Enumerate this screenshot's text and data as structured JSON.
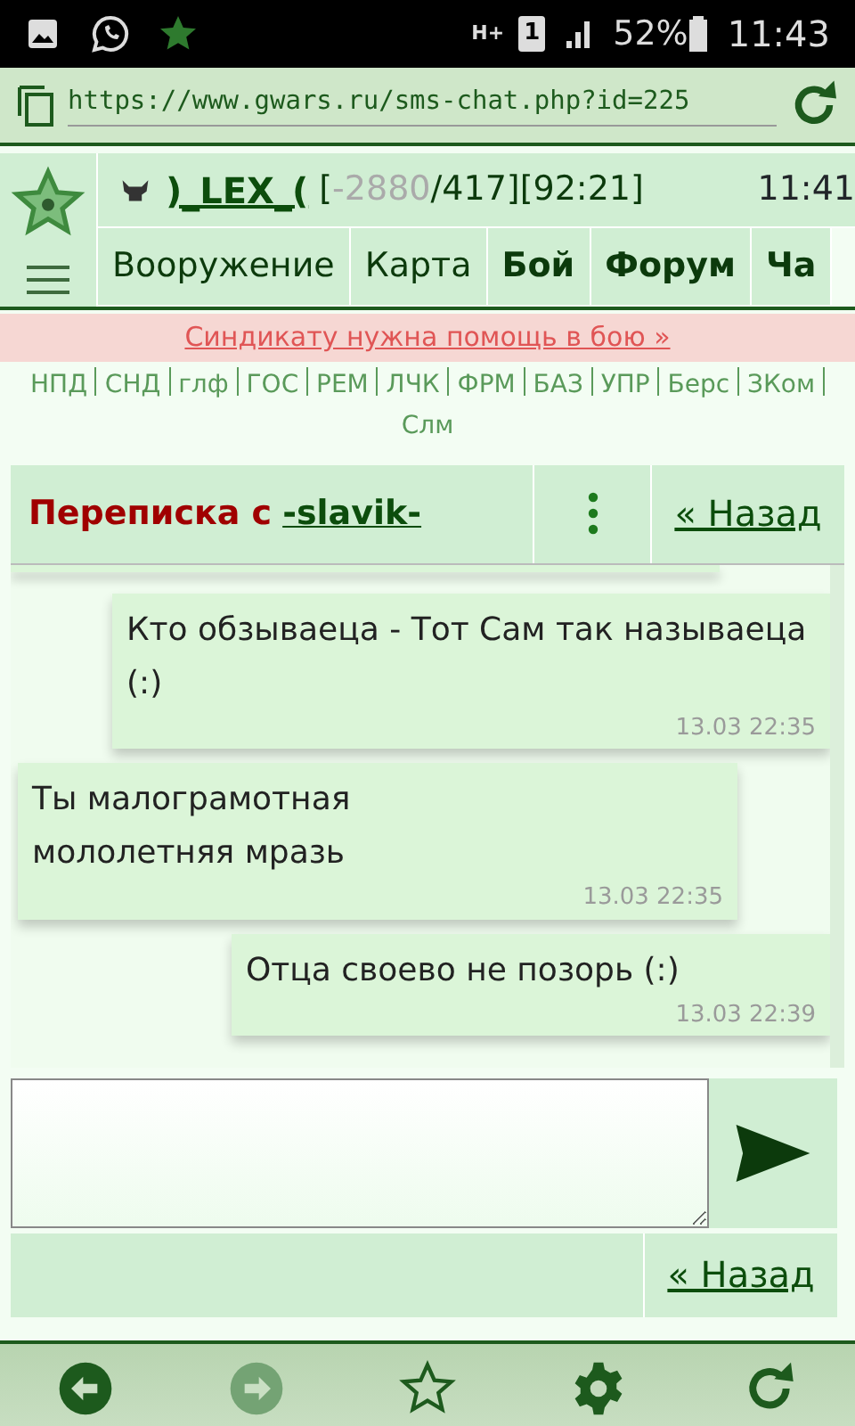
{
  "status_bar": {
    "network": "H+",
    "sim": "1",
    "battery": "52%",
    "time": "11:43"
  },
  "browser": {
    "url": "https://www.gwars.ru/sms-chat.php?id=225"
  },
  "header": {
    "player": ")_LEX_(",
    "stats": [
      {
        "text": "[",
        "kind": "plain"
      },
      {
        "text": "-2880",
        "kind": "muted"
      },
      {
        "text": "/417][92:21]",
        "kind": "plain"
      }
    ],
    "time": "11:41",
    "nav": [
      {
        "label": "Вооружение",
        "bold": false
      },
      {
        "label": "Карта",
        "bold": false
      },
      {
        "label": "Бой",
        "bold": true
      },
      {
        "label": "Форум",
        "bold": true
      },
      {
        "label": "Ча",
        "bold": true
      }
    ]
  },
  "alert": "Синдикату нужна помощь в бою »",
  "quick_links": [
    "НПД",
    "СНД",
    "глф",
    "ГОС",
    "РЕМ",
    "ЛЧК",
    "ФРМ",
    "БАЗ",
    "УПР",
    "Берс",
    "ЗКом",
    "Слм"
  ],
  "chat": {
    "title": "Переписка с",
    "contact": "-slavik-",
    "back": "« Назад",
    "messages": [
      {
        "kind": "out",
        "text": "Кто обзываеца - Тот Сам так называеца (:)",
        "time": "13.03 22:35"
      },
      {
        "kind": "in",
        "text": "Ты малограмотная мололетняя мразь",
        "time": "13.03 22:35"
      },
      {
        "kind": "out",
        "text": "Отца своево не позорь (:)",
        "time": "13.03 22:39"
      }
    ],
    "footer_back": "« Назад"
  },
  "toolbar": [
    {
      "kind": "back",
      "disabled": false
    },
    {
      "kind": "forward",
      "disabled": true
    },
    {
      "kind": "star",
      "disabled": false
    },
    {
      "kind": "settings",
      "disabled": false
    },
    {
      "kind": "reload",
      "disabled": false
    }
  ]
}
